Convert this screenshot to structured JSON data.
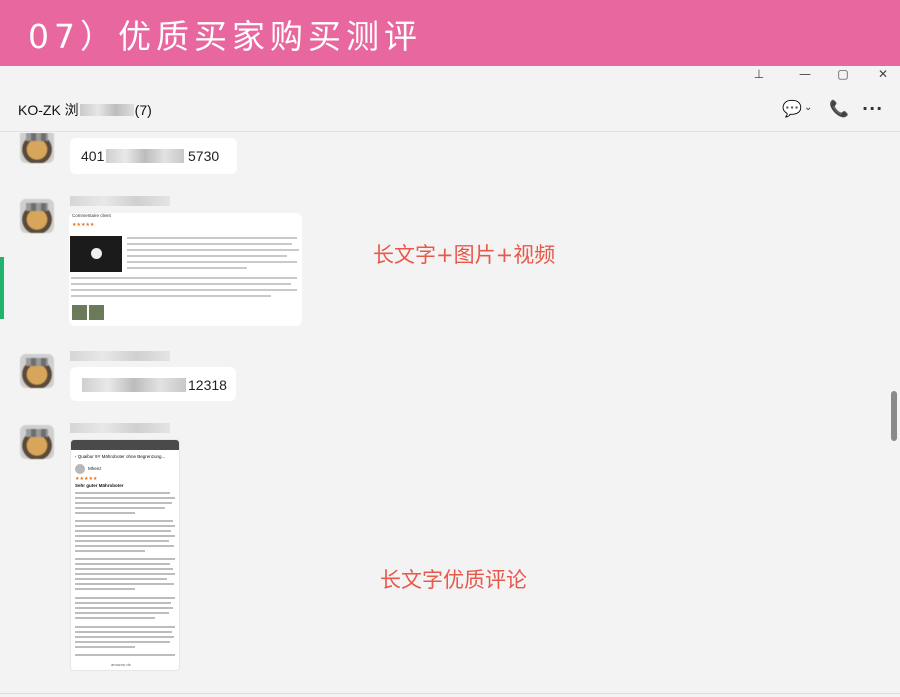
{
  "banner": {
    "title": "07）优质买家购买测评"
  },
  "window": {
    "pin_icon": "pin-icon",
    "minimize_icon": "minimize-icon",
    "maximize_icon": "maximize-icon",
    "close_icon": "close-icon",
    "pin_glyph": "⊥",
    "minimize_glyph": "—",
    "maximize_glyph": "▢",
    "close_glyph": "✕"
  },
  "header": {
    "title_prefix": "KO-ZK 浏",
    "title_suffix": "(7)",
    "message_glyph": "💬",
    "caret_glyph": "⌄",
    "call_glyph": "📞",
    "more_glyph": "···"
  },
  "messages": [
    {
      "type": "text",
      "visible_start": "401",
      "visible_end": "5730"
    },
    {
      "type": "image",
      "image_title": "Commentaire client",
      "annotation": "长文字+图片+视频"
    },
    {
      "type": "text",
      "visible_start": "",
      "visible_end": "12318"
    },
    {
      "type": "image",
      "nav_text": "‹ Quaibur 9Y Mähroboter ohne Begrenzung...",
      "reviewer": "Mhenz",
      "review_title": "Sehr guter Mähroboter",
      "footer": "amazon.de",
      "annotation": "长文字优质评论"
    }
  ],
  "colors": {
    "banner": "#e8679e",
    "annotation": "#e8584b",
    "active_bar": "#21b36b"
  }
}
